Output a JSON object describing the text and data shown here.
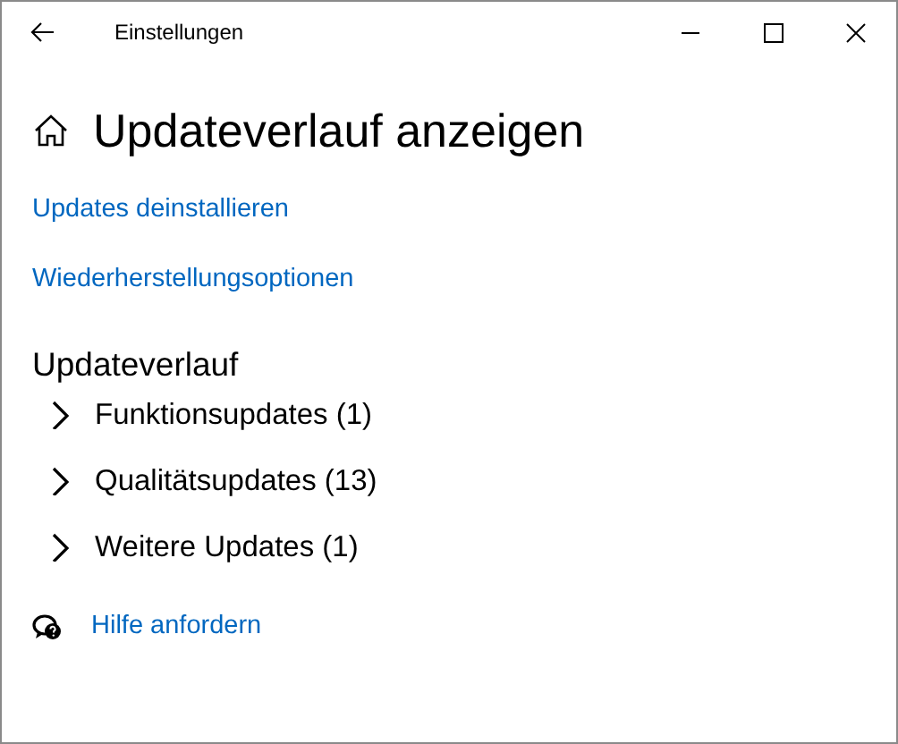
{
  "window": {
    "title": "Einstellungen"
  },
  "page": {
    "title": "Updateverlauf anzeigen"
  },
  "links": [
    "Updates deinstallieren",
    "Wiederherstellungsoptionen"
  ],
  "history": {
    "title": "Updateverlauf",
    "groups": [
      {
        "label": "Funktionsupdates (1)",
        "expanded": false
      },
      {
        "label": "Qualitätsupdates (13)",
        "expanded": false
      },
      {
        "label": "Weitere Updates (1)",
        "expanded": false
      }
    ]
  },
  "help": {
    "label": "Hilfe anfordern"
  }
}
